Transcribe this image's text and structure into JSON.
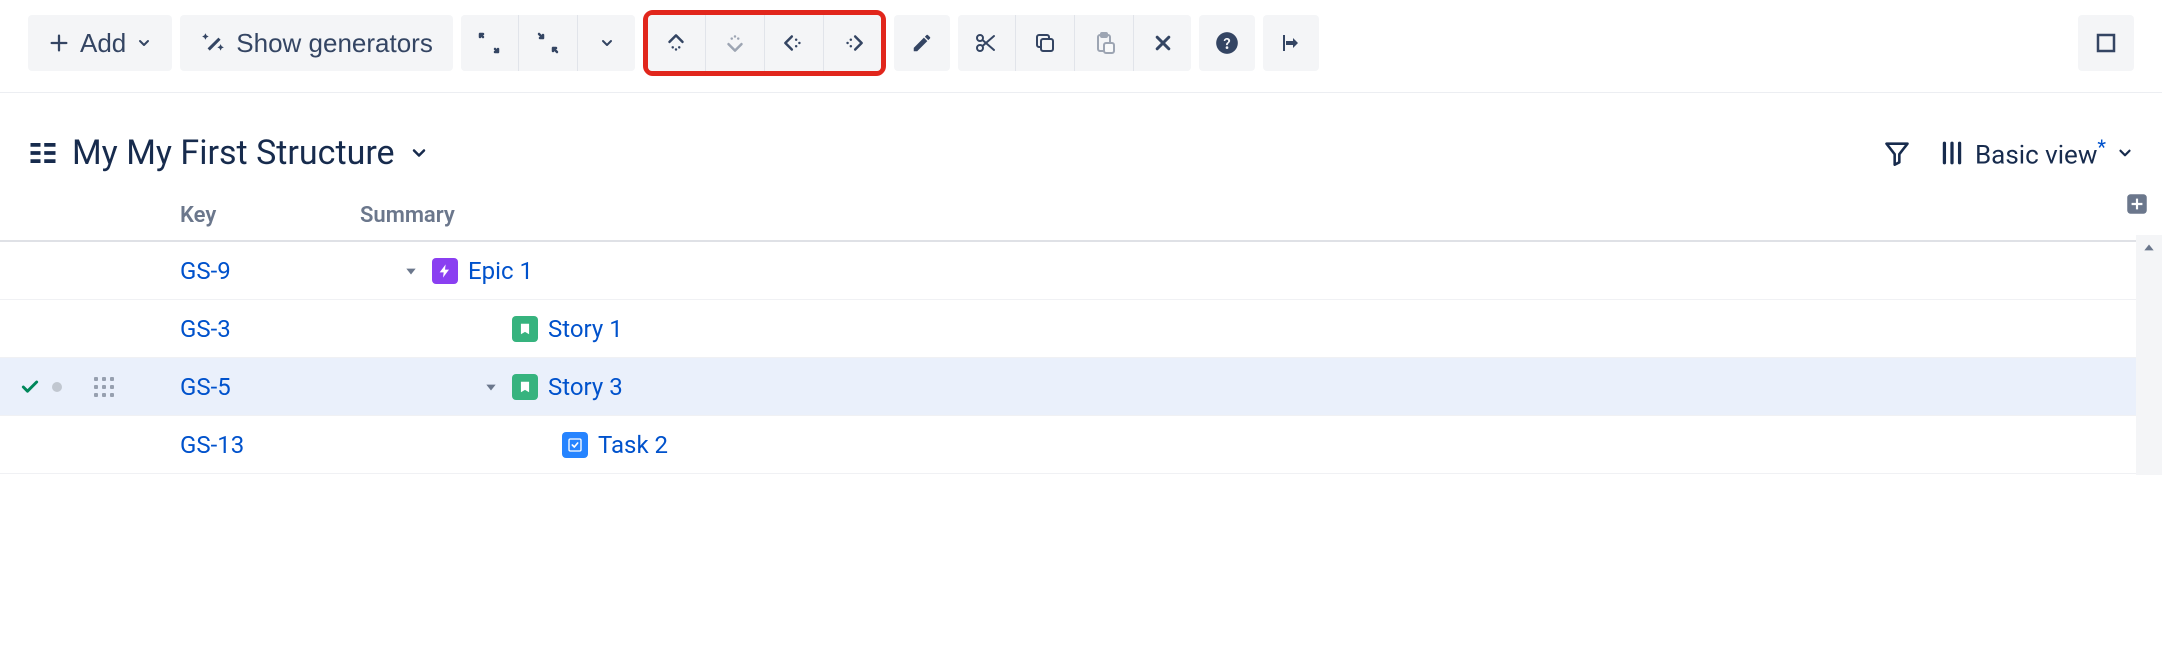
{
  "toolbar": {
    "add_label": "Add",
    "show_generators_label": "Show generators"
  },
  "header": {
    "title": "My My First Structure",
    "view_label": "Basic view"
  },
  "columns": {
    "key": "Key",
    "summary": "Summary"
  },
  "rows": [
    {
      "key": "GS-9",
      "summary": "Epic 1",
      "type": "epic",
      "indent": 1,
      "expandable": true,
      "selected": false
    },
    {
      "key": "GS-3",
      "summary": "Story 1",
      "type": "story",
      "indent": 2,
      "expandable": false,
      "selected": false
    },
    {
      "key": "GS-5",
      "summary": "Story 3",
      "type": "story",
      "indent": 2,
      "expandable": true,
      "selected": true
    },
    {
      "key": "GS-13",
      "summary": "Task 2",
      "type": "task",
      "indent": 3,
      "expandable": false,
      "selected": false
    }
  ],
  "issue_type_icons": {
    "epic": "⚡",
    "story": "◣",
    "task": "◧"
  }
}
